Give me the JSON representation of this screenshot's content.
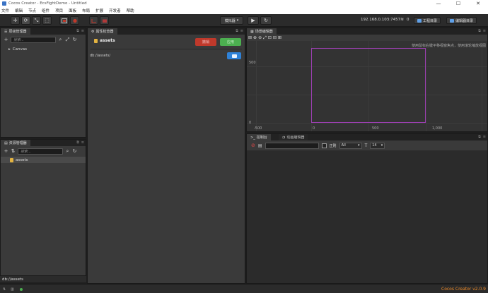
{
  "window": {
    "title": "Cocos Creator - EcsFightDemo - Untitled",
    "controls": {
      "minimize": "—",
      "maximize": "☐",
      "close": "✕"
    }
  },
  "menubar": [
    "文件",
    "编辑",
    "节点",
    "组件",
    "项目",
    "面板",
    "布局",
    "扩展",
    "开发者",
    "帮助"
  ],
  "toolbar": {
    "tools": [
      "✛",
      "⟳",
      "⤡",
      "⬚"
    ],
    "preview_select": "模拟器",
    "ip": "192.168.0.103:7457",
    "connections": "0",
    "project_folder": "工程目录",
    "editor_folder": "编辑器目录"
  },
  "hierarchy": {
    "tab": "层级管理器",
    "search_placeholder": "搜索...",
    "items": [
      {
        "label": "Canvas"
      }
    ]
  },
  "assets": {
    "tab": "资源管理器",
    "search_placeholder": "搜索...",
    "items": [
      {
        "label": "assets"
      }
    ],
    "path": "db://assets"
  },
  "inspector": {
    "tab": "属性检查器",
    "title": "assets",
    "revert": "撤销",
    "apply": "应用",
    "path": "db://assets/"
  },
  "scene": {
    "tab": "场景编辑器",
    "hint": "使用鼠标右键平移视窗焦点，使用滚轮缩放视图",
    "tools": [
      "⊞",
      "⊕",
      "⊖",
      "⤢",
      "⊡",
      "⊟",
      "⊞"
    ],
    "x_labels": [
      "-500",
      "0",
      "500",
      "1,000"
    ],
    "y_labels": [
      "500",
      "0"
    ]
  },
  "console": {
    "tabs": [
      "控制台",
      "动画编辑器"
    ],
    "regex_label": "正则",
    "level_select": "All",
    "font_size": "14"
  },
  "status": {
    "version": "Cocos Creator v2.0.9",
    "colors": {
      "version": "#f28c28",
      "revert": "#c0392b",
      "apply": "#4caf50"
    }
  }
}
